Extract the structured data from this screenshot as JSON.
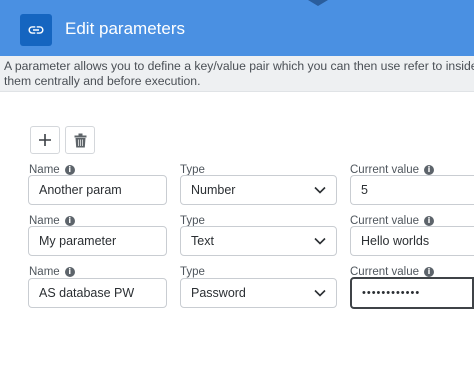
{
  "header": {
    "title": "Edit parameters",
    "icon": "link-icon",
    "accent_color": "#4a90e2",
    "icon_bg_color": "#1565c0"
  },
  "description": {
    "line1": "A parameter allows you to define a key/value pair which you can then use refer to inside y",
    "line2": "them centrally and before execution."
  },
  "toolbar": {
    "add_icon": "plus-icon",
    "delete_icon": "trash-icon"
  },
  "labels": {
    "name": "Name",
    "type": "Type",
    "current_value": "Current value",
    "info_glyph": "i"
  },
  "parameters": [
    {
      "name": "Another param",
      "type": "Number",
      "value": "5"
    },
    {
      "name": "My parameter",
      "type": "Text",
      "value": "Hello worlds"
    },
    {
      "name": "AS database PW",
      "type": "Password",
      "value": "••••••••••••"
    }
  ]
}
